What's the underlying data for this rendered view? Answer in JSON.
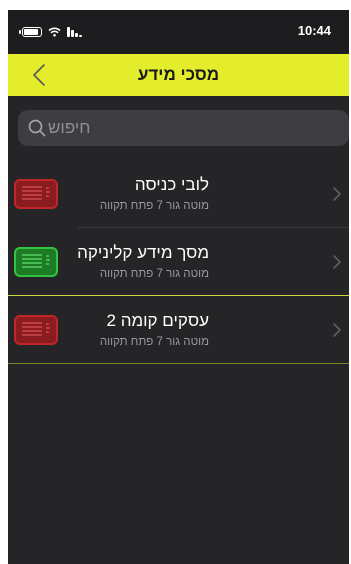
{
  "status_bar": {
    "time": "10:44",
    "icons": [
      "battery-icon",
      "wifi-icon",
      "signal-icon"
    ]
  },
  "nav": {
    "title": "מסכי מידע",
    "back_icon": "chevron-left-icon",
    "background": "#e3ed2c"
  },
  "search": {
    "placeholder": "חיפוש",
    "icon": "search-icon"
  },
  "items": [
    {
      "title": "לובי כניסה",
      "subtitle": "מוטה גור 7 פתח תקווה",
      "status": "offline",
      "status_color": "#c0262a",
      "separator_color": "#3a3a3c"
    },
    {
      "title": "מסך מידע קליניקה",
      "subtitle": "מוטה גור 7 פתח תקווה",
      "status": "online",
      "status_color": "#31c43e",
      "separator_color": "#cfd83a"
    },
    {
      "title": "עסקים קומה 2",
      "subtitle": "מוטה גור 7 פתח תקווה",
      "status": "offline",
      "status_color": "#c0262a",
      "separator_color": "#7d8426"
    }
  ],
  "colors": {
    "background": "#252527",
    "text": "#ffffff",
    "subtitle": "#9a9a9e"
  }
}
